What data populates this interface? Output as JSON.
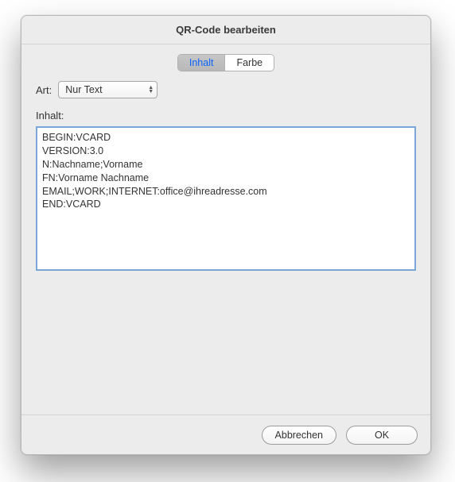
{
  "dialog": {
    "title": "QR-Code bearbeiten"
  },
  "tabs": {
    "inhalt": "Inhalt",
    "farbe": "Farbe"
  },
  "art": {
    "label": "Art:",
    "value": "Nur Text"
  },
  "inhalt": {
    "label": "Inhalt:",
    "text": "BEGIN:VCARD\nVERSION:3.0\nN:Nachname;Vorname\nFN:Vorname Nachname\nEMAIL;WORK;INTERNET:office@ihreadresse.com\nEND:VCARD"
  },
  "buttons": {
    "cancel": "Abbrechen",
    "ok": "OK"
  }
}
